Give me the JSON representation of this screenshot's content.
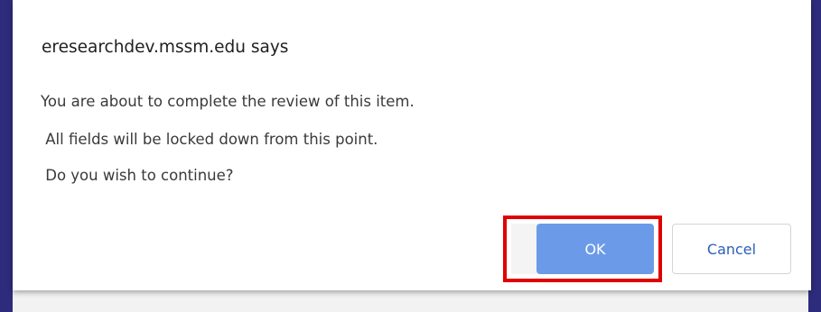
{
  "dialog": {
    "title": "eresearchdev.mssm.edu says",
    "message_lines": [
      "You are about to complete the review of this item.",
      " All fields will be locked down from this point.",
      " Do you wish to continue?"
    ],
    "ok_label": "OK",
    "cancel_label": "Cancel"
  },
  "colors": {
    "background": "#2d2c7c",
    "ok_button": "#6b9be8",
    "cancel_text": "#2d5fb8",
    "highlight": "#e00000"
  }
}
